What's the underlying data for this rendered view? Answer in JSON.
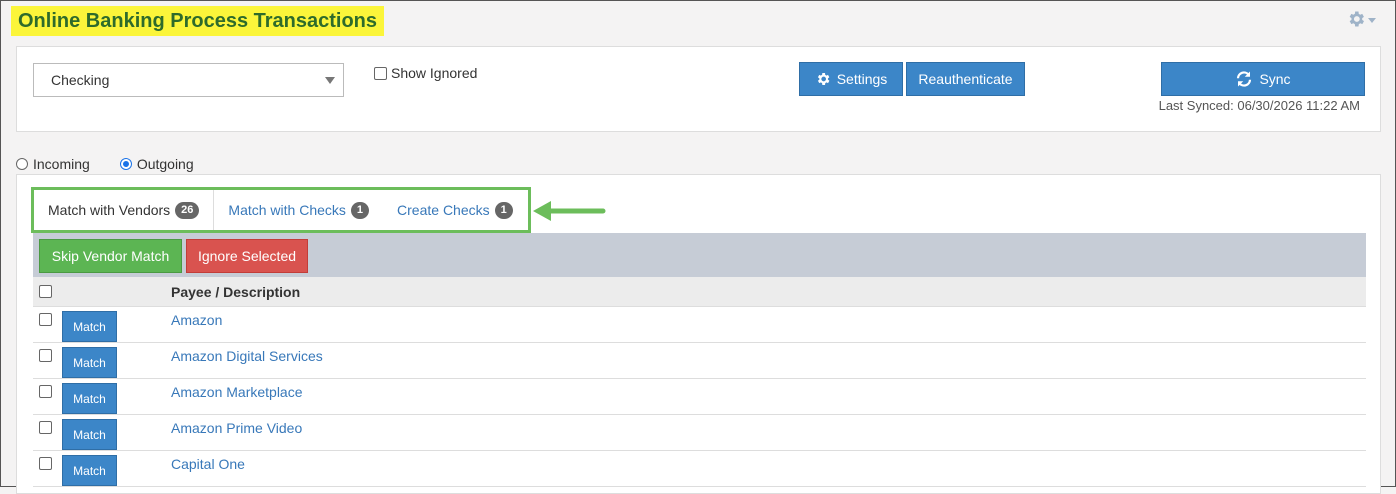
{
  "page": {
    "title": "Online Banking Process Transactions",
    "gear_icon": "gear-icon"
  },
  "top_panel": {
    "account_select": {
      "value": "Checking"
    },
    "show_ignored_label": "Show Ignored",
    "settings_label": "Settings",
    "reauthenticate_label": "Reauthenticate",
    "sync_label": "Sync",
    "last_synced": "Last Synced: 06/30/2026 11:22 AM"
  },
  "direction": {
    "incoming_label": "Incoming",
    "outgoing_label": "Outgoing",
    "selected": "Outgoing"
  },
  "tabs": [
    {
      "label": "Match with Vendors",
      "count": "26",
      "active": true
    },
    {
      "label": "Match with Checks",
      "count": "1",
      "active": false
    },
    {
      "label": "Create Checks",
      "count": "1",
      "active": false
    }
  ],
  "actions": {
    "skip_vendor_match_label": "Skip Vendor Match",
    "ignore_selected_label": "Ignore Selected"
  },
  "table": {
    "header": "Payee / Description",
    "match_label": "Match",
    "rows": [
      {
        "payee": "Amazon"
      },
      {
        "payee": "Amazon Digital Services"
      },
      {
        "payee": "Amazon Marketplace"
      },
      {
        "payee": "Amazon Prime Video"
      },
      {
        "payee": "Capital One"
      }
    ]
  },
  "colors": {
    "title_highlight": "#fbf53a",
    "title_text": "#2e6b2b",
    "primary_button": "#3c86c8",
    "success_button": "#5cb553",
    "danger_button": "#d9534f",
    "callout_green": "#6cbd5b"
  }
}
